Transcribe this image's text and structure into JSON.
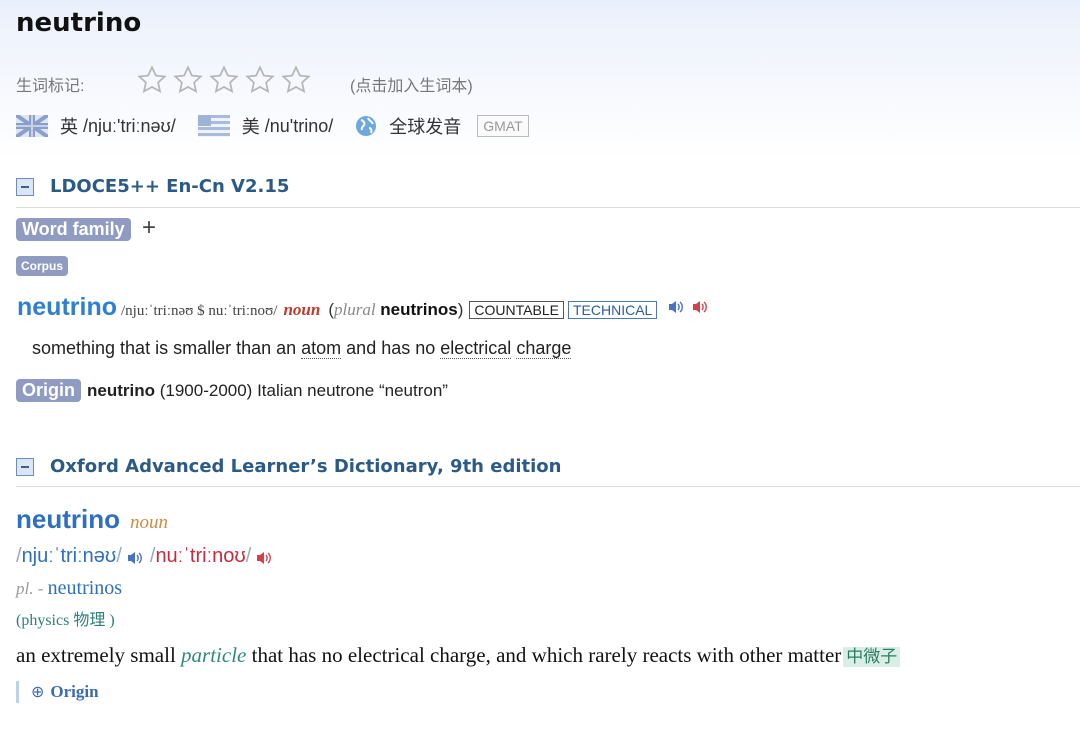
{
  "header": {
    "headword": "neutrino",
    "stars_label": "生词标记:",
    "star_count": 5,
    "stars_hint": "(点击加入生词本)",
    "uk_label": "英",
    "uk_ipa": "/njuː'triːnəʊ/",
    "us_label": "美",
    "us_ipa": "/nu'trino/",
    "global_label": "全球发音",
    "exam_tag": "GMAT"
  },
  "ldoce": {
    "section_title": "LDOCE5++ En-Cn V2.15",
    "word_family_label": "Word family",
    "word_family_toggle": "+",
    "corpus_label": "Corpus",
    "headword": "neutrino",
    "ipa": "/njuːˈtriːnəʊ $ nuːˈtriːnoʊ/",
    "pos": "noun",
    "plural_open": "(",
    "plural_label": "plural",
    "plural_form": "neutrinos",
    "plural_close": ")",
    "grammar_tag": "COUNTABLE",
    "register_tag": "TECHNICAL",
    "definition": {
      "part1": "something that is smaller than an ",
      "link1": "atom",
      "part2": " and has no ",
      "link2": "electrical",
      "part3": " ",
      "link3": "charge"
    },
    "origin_label": "Origin",
    "origin_word": "neutrino",
    "origin_text": " (1900-2000) Italian neutrone “neutron”"
  },
  "oxford": {
    "section_title": "Oxford Advanced Learner’s Dictionary, 9th edition",
    "headword": "neutrino",
    "pos": "noun",
    "br_ipa": "njuːˈtriːnəʊ",
    "us_ipa": "nuːˈtriːnoʊ",
    "slash": "/",
    "plural_abbr": "pl.",
    "plural_dash": " - ",
    "plural_form": "neutrinos",
    "domain": "(physics 物理 )",
    "definition": {
      "part1": "an extremely small ",
      "emphasis": "particle",
      "part2": " that has no electrical charge, and which rarely reacts with other matter"
    },
    "translation": "中微子",
    "origin_icon": "⊕",
    "origin_label": "Origin"
  },
  "icons": {
    "star": "star-outline-icon",
    "uk_flag": "uk-flag-icon",
    "us_flag": "us-flag-icon",
    "globe": "globe-icon",
    "speaker": "speaker-icon",
    "collapse": "minus-box-icon"
  },
  "colors": {
    "ldoce_headword": "#2e7fd0",
    "oxford_headword": "#2f6fc0",
    "section_title": "#2b5a86",
    "pill_bg": "#8f9bc1",
    "noun_red": "#c0392b",
    "us_red": "#c62b3b",
    "translation_bg": "#d9efe6"
  }
}
